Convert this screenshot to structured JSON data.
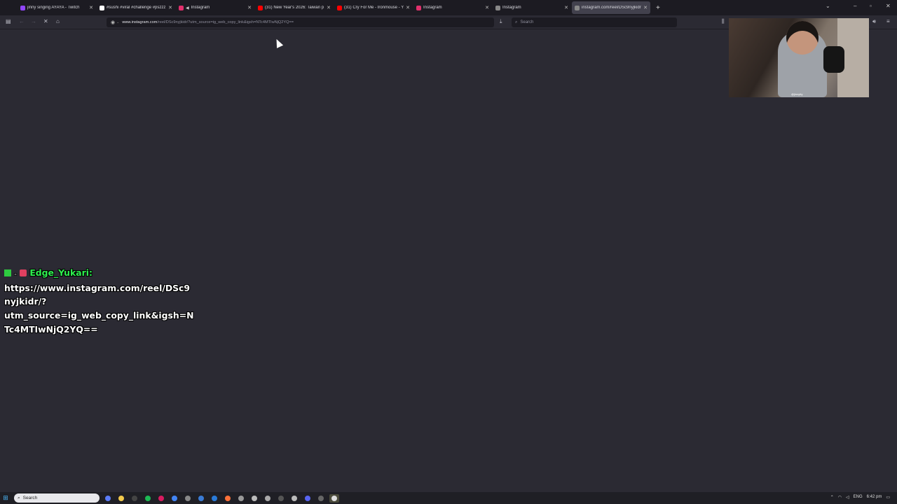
{
  "browser": {
    "tabs": [
      {
        "title": "jinny singing AYAYA - Twitch",
        "color": "#9146ff",
        "audio": false,
        "active": false
      },
      {
        "title": "#sushi #viral #challenge #pszzz",
        "color": "#ffffff",
        "audio": false,
        "active": false
      },
      {
        "title": "Instagram",
        "color": "#e1306c",
        "audio": true,
        "active": false
      },
      {
        "title": "(31) New Year's 2026: Taiwan p",
        "color": "#ff0000",
        "audio": false,
        "active": false
      },
      {
        "title": "(31) Cry For Me - Ironmouse - Y",
        "color": "#ff0000",
        "audio": false,
        "active": false
      },
      {
        "title": "Instagram",
        "color": "#e1306c",
        "audio": false,
        "active": false
      },
      {
        "title": "Instagram",
        "color": "#888888",
        "audio": false,
        "active": false
      },
      {
        "title": "instagram.com/reel/DSc9nyjkidr",
        "color": "#888888",
        "audio": false,
        "active": true
      }
    ],
    "new_tab": "+",
    "url_host": "www.instagram.com",
    "url_rest": "/reel/DSc9nyjkidr/?utm_source=ig_web_copy_link&igsh=NTc4MTIwNjQ2YQ==",
    "search_placeholder": "Search"
  },
  "chat": {
    "username": "Edge_Yukari:",
    "lines": [
      "https://www.instagram.com/reel/DSc9",
      "nyjkidr/?",
      "utm_source=ig_web_copy_link&igsh=N",
      "Tc4MTIwNjQ2YQ=="
    ]
  },
  "webcam": {
    "tag": "@jinnytty"
  },
  "taskbar": {
    "search_label": "Search",
    "apps": [
      {
        "icon": "orbit-icon",
        "color": "#5b7cfa"
      },
      {
        "icon": "folder-icon",
        "color": "#f2c94c"
      },
      {
        "icon": "slash-icon",
        "color": "#444"
      },
      {
        "icon": "spotify-icon",
        "color": "#1db954"
      },
      {
        "icon": "record-icon",
        "color": "#d81b60"
      },
      {
        "icon": "chrome-icon",
        "color": "#4285f4"
      },
      {
        "icon": "check-icon",
        "color": "#888"
      },
      {
        "icon": "box-icon",
        "color": "#3a7bd5"
      },
      {
        "icon": "steam-icon",
        "color": "#2a7ad8"
      },
      {
        "icon": "firefox-icon",
        "color": "#ff7139"
      },
      {
        "icon": "tag-icon",
        "color": "#999"
      },
      {
        "icon": "gear-icon",
        "color": "#bbb"
      },
      {
        "icon": "leaf-icon",
        "color": "#aaa"
      },
      {
        "icon": "clipboard-icon",
        "color": "#555"
      },
      {
        "icon": "pen-icon",
        "color": "#bbb"
      },
      {
        "icon": "discord-icon",
        "color": "#5865f2"
      },
      {
        "icon": "monitor-icon",
        "color": "#666"
      },
      {
        "icon": "obs-icon",
        "color": "#ddd"
      }
    ],
    "language": "ENG",
    "time": "6:42 pm"
  }
}
